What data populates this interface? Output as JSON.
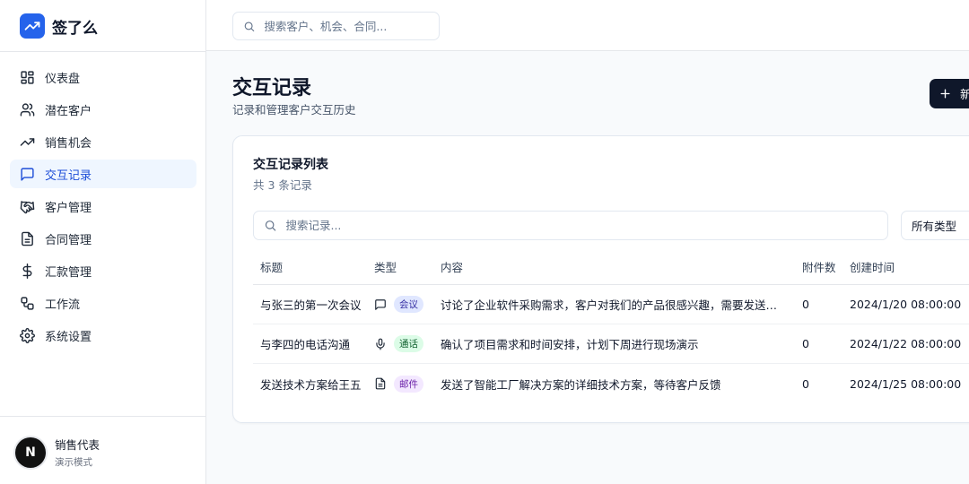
{
  "app": {
    "name": "签了么",
    "brand_color": "#2563eb"
  },
  "sidebar": {
    "items": [
      {
        "label": "仪表盘",
        "icon": "dashboard-icon",
        "active": false
      },
      {
        "label": "潜在客户",
        "icon": "users-icon",
        "active": false
      },
      {
        "label": "销售机会",
        "icon": "trending-up-icon",
        "active": false
      },
      {
        "label": "交互记录",
        "icon": "message-square-icon",
        "active": true
      },
      {
        "label": "客户管理",
        "icon": "handshake-icon",
        "active": false
      },
      {
        "label": "合同管理",
        "icon": "file-text-icon",
        "active": false
      },
      {
        "label": "汇款管理",
        "icon": "dollar-icon",
        "active": false
      },
      {
        "label": "工作流",
        "icon": "workflow-icon",
        "active": false
      },
      {
        "label": "系统设置",
        "icon": "settings-icon",
        "active": false
      }
    ],
    "user": {
      "avatar_letter": "N",
      "name": "销售代表",
      "role": "演示模式"
    }
  },
  "topbar": {
    "search_placeholder": "搜索客户、机会、合同..."
  },
  "page": {
    "title": "交互记录",
    "subtitle": "记录和管理客户交互历史",
    "new_button_label": "新"
  },
  "card": {
    "title": "交互记录列表",
    "count_text": "共 3 条记录",
    "search_placeholder": "搜索记录...",
    "type_filter_value": "所有类型",
    "columns": [
      "标题",
      "类型",
      "内容",
      "附件数",
      "创建时间"
    ],
    "rows": [
      {
        "title": "与张三的第一次会议",
        "type": "会议",
        "type_icon": "message-square-icon",
        "content": "讨论了企业软件采购需求，客户对我们的产品很感兴趣，需要发送详细资料",
        "attachments": "0",
        "created": "2024/1/20 08:00:00"
      },
      {
        "title": "与李四的电话沟通",
        "type": "通话",
        "type_icon": "mic-icon",
        "content": "确认了项目需求和时间安排，计划下周进行现场演示",
        "attachments": "0",
        "created": "2024/1/22 08:00:00"
      },
      {
        "title": "发送技术方案给王五",
        "type": "邮件",
        "type_icon": "file-text-icon",
        "content": "发送了智能工厂解决方案的详细技术方案，等待客户反馈",
        "attachments": "0",
        "created": "2024/1/25 08:00:00"
      }
    ]
  }
}
